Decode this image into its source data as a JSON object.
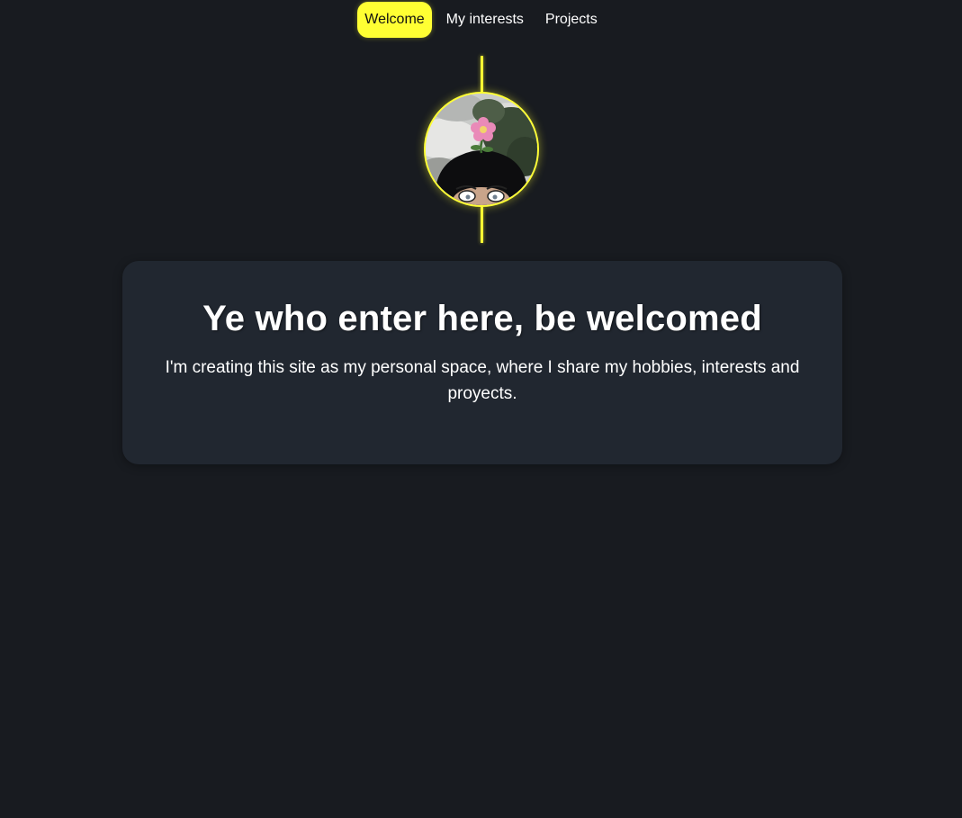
{
  "nav": {
    "items": [
      {
        "label": "Welcome",
        "active": true
      },
      {
        "label": "My interests",
        "active": false
      },
      {
        "label": "Projects",
        "active": false
      }
    ]
  },
  "avatar": {
    "icon": "profile-avatar-icon"
  },
  "card": {
    "title": "Ye who enter here, be welcomed",
    "text": "I'm creating this site as my personal space, where I share my hobbies, interests and proyects."
  },
  "colors": {
    "background": "#181b20",
    "card": "#212730",
    "accent": "#ffff33",
    "text": "#ffffff"
  }
}
